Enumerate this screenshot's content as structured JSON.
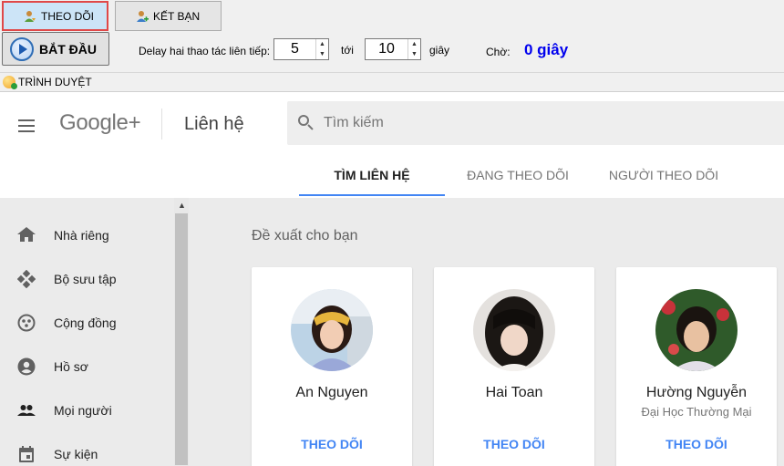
{
  "toolbar": {
    "follow_tab": "THEO DÕI",
    "friend_tab": "KẾT BẠN",
    "start_label": "BẮT ĐẦU",
    "delay_label": "Delay hai thao tác liên tiếp:",
    "delay_from": "5",
    "to_label": "tới",
    "delay_to": "10",
    "unit_label": "giây",
    "wait_label": "Chờ:",
    "wait_value": "0 giây"
  },
  "browser": {
    "label": "TRÌNH DUYỆT"
  },
  "gplus": {
    "logo": "Google+",
    "page_title": "Liên hệ",
    "search_placeholder": "Tìm kiếm",
    "tabs": [
      {
        "label": "TÌM LIÊN HỆ",
        "active": true
      },
      {
        "label": "ĐANG THEO DÕI",
        "active": false
      },
      {
        "label": "NGƯỜI THEO DÕI",
        "active": false
      }
    ],
    "nav": [
      {
        "label": "Nhà riêng",
        "icon": "home-icon"
      },
      {
        "label": "Bộ sưu tập",
        "icon": "collections-icon"
      },
      {
        "label": "Cộng đồng",
        "icon": "communities-icon"
      },
      {
        "label": "Hồ sơ",
        "icon": "profile-icon"
      },
      {
        "label": "Mọi người",
        "icon": "people-icon"
      },
      {
        "label": "Sự kiện",
        "icon": "events-icon"
      }
    ],
    "suggest_title": "Đề xuất cho bạn",
    "cards": [
      {
        "name": "An Nguyen",
        "subtitle": "",
        "follow": "THEO DÕI"
      },
      {
        "name": "Hai Toan",
        "subtitle": "",
        "follow": "THEO DÕI"
      },
      {
        "name": "Hường Nguyễn",
        "subtitle": "Đại Học Thường Mại",
        "follow": "THEO DÕI"
      }
    ]
  },
  "colors": {
    "accent": "#4285f4",
    "wait": "#0000ee",
    "active_tab_border": "#e04848"
  }
}
